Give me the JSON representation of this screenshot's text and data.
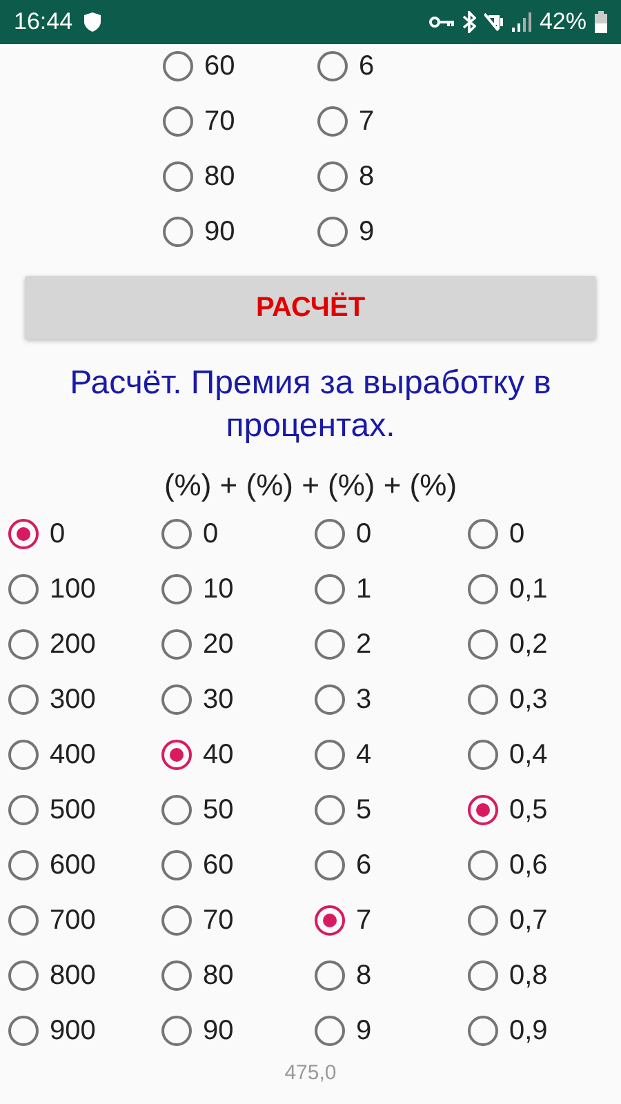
{
  "status_bar": {
    "time": "16:44",
    "battery": "42%"
  },
  "top_group": {
    "columns": [
      {
        "options": [
          {
            "label": "60",
            "selected": false
          },
          {
            "label": "70",
            "selected": false
          },
          {
            "label": "80",
            "selected": false
          },
          {
            "label": "90",
            "selected": false
          }
        ]
      },
      {
        "options": [
          {
            "label": "6",
            "selected": false
          },
          {
            "label": "7",
            "selected": false
          },
          {
            "label": "8",
            "selected": false
          },
          {
            "label": "9",
            "selected": false
          }
        ]
      }
    ]
  },
  "calculate_button": "РАСЧЁТ",
  "title": "Расчёт. Премия за выработку в процентах.",
  "formula": "(%) + (%) + (%) + (%)",
  "grid": {
    "columns": [
      {
        "options": [
          {
            "label": "0",
            "selected": true
          },
          {
            "label": "100",
            "selected": false
          },
          {
            "label": "200",
            "selected": false
          },
          {
            "label": "300",
            "selected": false
          },
          {
            "label": "400",
            "selected": false
          },
          {
            "label": "500",
            "selected": false
          },
          {
            "label": "600",
            "selected": false
          },
          {
            "label": "700",
            "selected": false
          },
          {
            "label": "800",
            "selected": false
          },
          {
            "label": "900",
            "selected": false
          }
        ]
      },
      {
        "options": [
          {
            "label": "0",
            "selected": false
          },
          {
            "label": "10",
            "selected": false
          },
          {
            "label": "20",
            "selected": false
          },
          {
            "label": "30",
            "selected": false
          },
          {
            "label": "40",
            "selected": true
          },
          {
            "label": "50",
            "selected": false
          },
          {
            "label": "60",
            "selected": false
          },
          {
            "label": "70",
            "selected": false
          },
          {
            "label": "80",
            "selected": false
          },
          {
            "label": "90",
            "selected": false
          }
        ]
      },
      {
        "options": [
          {
            "label": "0",
            "selected": false
          },
          {
            "label": "1",
            "selected": false
          },
          {
            "label": "2",
            "selected": false
          },
          {
            "label": "3",
            "selected": false
          },
          {
            "label": "4",
            "selected": false
          },
          {
            "label": "5",
            "selected": false
          },
          {
            "label": "6",
            "selected": false
          },
          {
            "label": "7",
            "selected": true
          },
          {
            "label": "8",
            "selected": false
          },
          {
            "label": "9",
            "selected": false
          }
        ]
      },
      {
        "options": [
          {
            "label": "0",
            "selected": false
          },
          {
            "label": "0,1",
            "selected": false
          },
          {
            "label": "0,2",
            "selected": false
          },
          {
            "label": "0,3",
            "selected": false
          },
          {
            "label": "0,4",
            "selected": false
          },
          {
            "label": "0,5",
            "selected": true
          },
          {
            "label": "0,6",
            "selected": false
          },
          {
            "label": "0,7",
            "selected": false
          },
          {
            "label": "0,8",
            "selected": false
          },
          {
            "label": "0,9",
            "selected": false
          }
        ]
      }
    ]
  },
  "result": "475,0"
}
